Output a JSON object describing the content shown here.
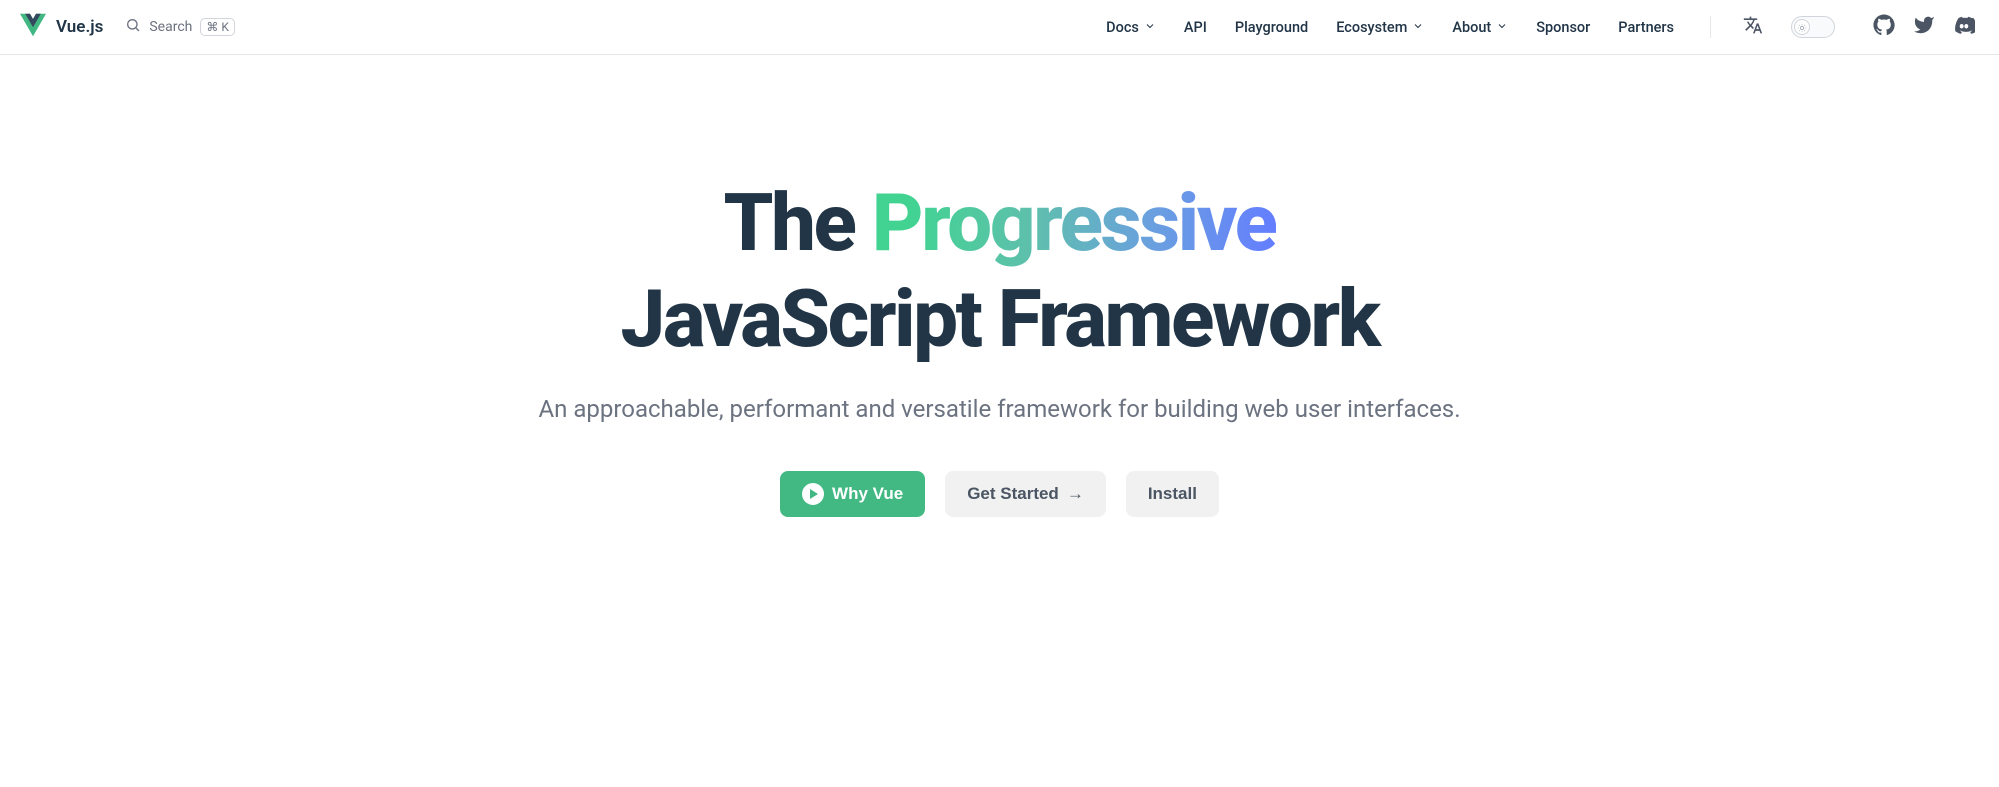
{
  "header": {
    "site_title": "Vue.js",
    "search_placeholder": "Search",
    "search_shortcut": "⌘ K",
    "nav": {
      "docs": "Docs",
      "api": "API",
      "playground": "Playground",
      "ecosystem": "Ecosystem",
      "about": "About",
      "sponsor": "Sponsor",
      "partners": "Partners"
    }
  },
  "hero": {
    "headline_pre": "The ",
    "headline_accent": "Progressive",
    "headline_post": "JavaScript Framework",
    "tagline": "An approachable, performant and versatile framework for building web user interfaces.",
    "actions": {
      "why": "Why Vue",
      "get_started": "Get Started",
      "get_started_arrow": "→",
      "install": "Install"
    }
  },
  "colors": {
    "brand_green": "#42b883",
    "brand_dark": "#213547"
  }
}
